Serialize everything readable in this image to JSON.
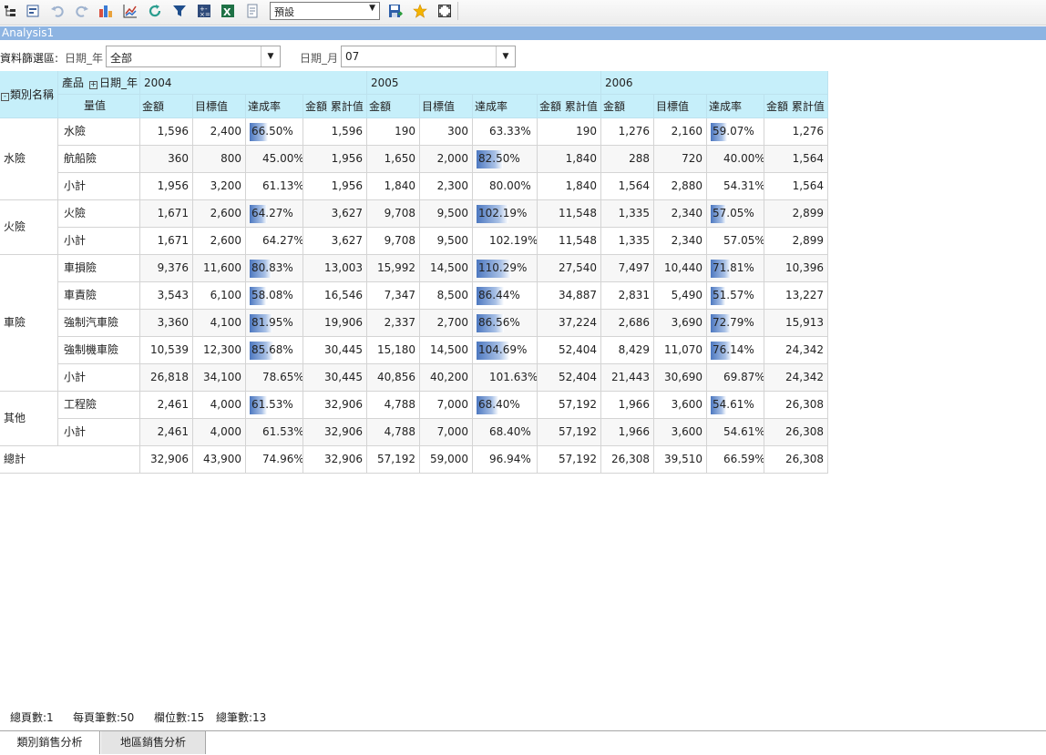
{
  "toolbar": {
    "icons": [
      "tree-icon",
      "form-icon",
      "undo-icon",
      "redo-icon",
      "bar-chart-icon",
      "line-chart-icon",
      "refresh-icon",
      "filter-icon",
      "calculator-icon",
      "excel-icon",
      "document-icon"
    ],
    "view_select": "預設",
    "save_icon": "save-icon",
    "favorite_icon": "star-icon",
    "fullscreen_icon": "fullscreen-icon"
  },
  "window": {
    "title": "Analysis1"
  },
  "filter": {
    "label": "資料篩選區:",
    "year_label": "日期_年",
    "year_value": "全部",
    "month_label": "日期_月",
    "month_value": "07"
  },
  "pivot": {
    "corner_category": "類別名稱",
    "corner_product": "產品",
    "corner_date": "日期_年",
    "corner_measure": "量值",
    "years": [
      "2004",
      "2005",
      "2006"
    ],
    "measures": [
      "金額",
      "目標值",
      "達成率",
      "金額 累計值"
    ],
    "rows": [
      {
        "category": "水險",
        "product": "水險",
        "values": [
          [
            "1,596",
            "2,400",
            "66.50%",
            "1,596"
          ],
          [
            "190",
            "300",
            "63.33%",
            "190"
          ],
          [
            "1,276",
            "2,160",
            "59.07%",
            "1,276"
          ]
        ],
        "bars": [
          0.665,
          null,
          0.5907
        ]
      },
      {
        "category": "",
        "product": "航船險",
        "values": [
          [
            "360",
            "800",
            "45.00%",
            "1,956"
          ],
          [
            "1,650",
            "2,000",
            "82.50%",
            "1,840"
          ],
          [
            "288",
            "720",
            "40.00%",
            "1,564"
          ]
        ],
        "bars": [
          null,
          0.825,
          null
        ]
      },
      {
        "category": "",
        "product": "小計",
        "values": [
          [
            "1,956",
            "3,200",
            "61.13%",
            "1,956"
          ],
          [
            "1,840",
            "2,300",
            "80.00%",
            "1,840"
          ],
          [
            "1,564",
            "2,880",
            "54.31%",
            "1,564"
          ]
        ],
        "bars": [
          null,
          null,
          null
        ]
      },
      {
        "category": "火險",
        "product": "火險",
        "values": [
          [
            "1,671",
            "2,600",
            "64.27%",
            "3,627"
          ],
          [
            "9,708",
            "9,500",
            "102.19%",
            "11,548"
          ],
          [
            "1,335",
            "2,340",
            "57.05%",
            "2,899"
          ]
        ],
        "bars": [
          0.6427,
          1.0219,
          0.5705
        ]
      },
      {
        "category": "",
        "product": "小計",
        "values": [
          [
            "1,671",
            "2,600",
            "64.27%",
            "3,627"
          ],
          [
            "9,708",
            "9,500",
            "102.19%",
            "11,548"
          ],
          [
            "1,335",
            "2,340",
            "57.05%",
            "2,899"
          ]
        ],
        "bars": [
          null,
          null,
          null
        ]
      },
      {
        "category": "車險",
        "product": "車損險",
        "values": [
          [
            "9,376",
            "11,600",
            "80.83%",
            "13,003"
          ],
          [
            "15,992",
            "14,500",
            "110.29%",
            "27,540"
          ],
          [
            "7,497",
            "10,440",
            "71.81%",
            "10,396"
          ]
        ],
        "bars": [
          0.8083,
          1.1029,
          0.7181
        ]
      },
      {
        "category": "",
        "product": "車責險",
        "values": [
          [
            "3,543",
            "6,100",
            "58.08%",
            "16,546"
          ],
          [
            "7,347",
            "8,500",
            "86.44%",
            "34,887"
          ],
          [
            "2,831",
            "5,490",
            "51.57%",
            "13,227"
          ]
        ],
        "bars": [
          0.5808,
          0.8644,
          0.5157
        ]
      },
      {
        "category": "",
        "product": "強制汽車險",
        "values": [
          [
            "3,360",
            "4,100",
            "81.95%",
            "19,906"
          ],
          [
            "2,337",
            "2,700",
            "86.56%",
            "37,224"
          ],
          [
            "2,686",
            "3,690",
            "72.79%",
            "15,913"
          ]
        ],
        "bars": [
          0.8195,
          0.8656,
          0.7279
        ]
      },
      {
        "category": "",
        "product": "強制機車險",
        "values": [
          [
            "10,539",
            "12,300",
            "85.68%",
            "30,445"
          ],
          [
            "15,180",
            "14,500",
            "104.69%",
            "52,404"
          ],
          [
            "8,429",
            "11,070",
            "76.14%",
            "24,342"
          ]
        ],
        "bars": [
          0.8568,
          1.0469,
          0.7614
        ]
      },
      {
        "category": "",
        "product": "小計",
        "values": [
          [
            "26,818",
            "34,100",
            "78.65%",
            "30,445"
          ],
          [
            "40,856",
            "40,200",
            "101.63%",
            "52,404"
          ],
          [
            "21,443",
            "30,690",
            "69.87%",
            "24,342"
          ]
        ],
        "bars": [
          null,
          null,
          null
        ]
      },
      {
        "category": "其他",
        "product": "工程險",
        "values": [
          [
            "2,461",
            "4,000",
            "61.53%",
            "32,906"
          ],
          [
            "4,788",
            "7,000",
            "68.40%",
            "57,192"
          ],
          [
            "1,966",
            "3,600",
            "54.61%",
            "26,308"
          ]
        ],
        "bars": [
          0.6153,
          0.684,
          0.5461
        ]
      },
      {
        "category": "",
        "product": "小計",
        "values": [
          [
            "2,461",
            "4,000",
            "61.53%",
            "32,906"
          ],
          [
            "4,788",
            "7,000",
            "68.40%",
            "57,192"
          ],
          [
            "1,966",
            "3,600",
            "54.61%",
            "26,308"
          ]
        ],
        "bars": [
          null,
          null,
          null
        ]
      },
      {
        "category": "總計",
        "product": "",
        "values": [
          [
            "32,906",
            "43,900",
            "74.96%",
            "32,906"
          ],
          [
            "57,192",
            "59,000",
            "96.94%",
            "57,192"
          ],
          [
            "26,308",
            "39,510",
            "66.59%",
            "26,308"
          ]
        ],
        "bars": [
          null,
          null,
          null
        ]
      }
    ]
  },
  "status": {
    "total_pages": "總頁數:1",
    "per_page": "每頁筆數:50",
    "columns": "欄位數:15",
    "total_records": "總筆數:13"
  },
  "tabs": [
    {
      "label": "類別銷售分析",
      "active": true
    },
    {
      "label": "地區銷售分析",
      "active": false
    }
  ]
}
